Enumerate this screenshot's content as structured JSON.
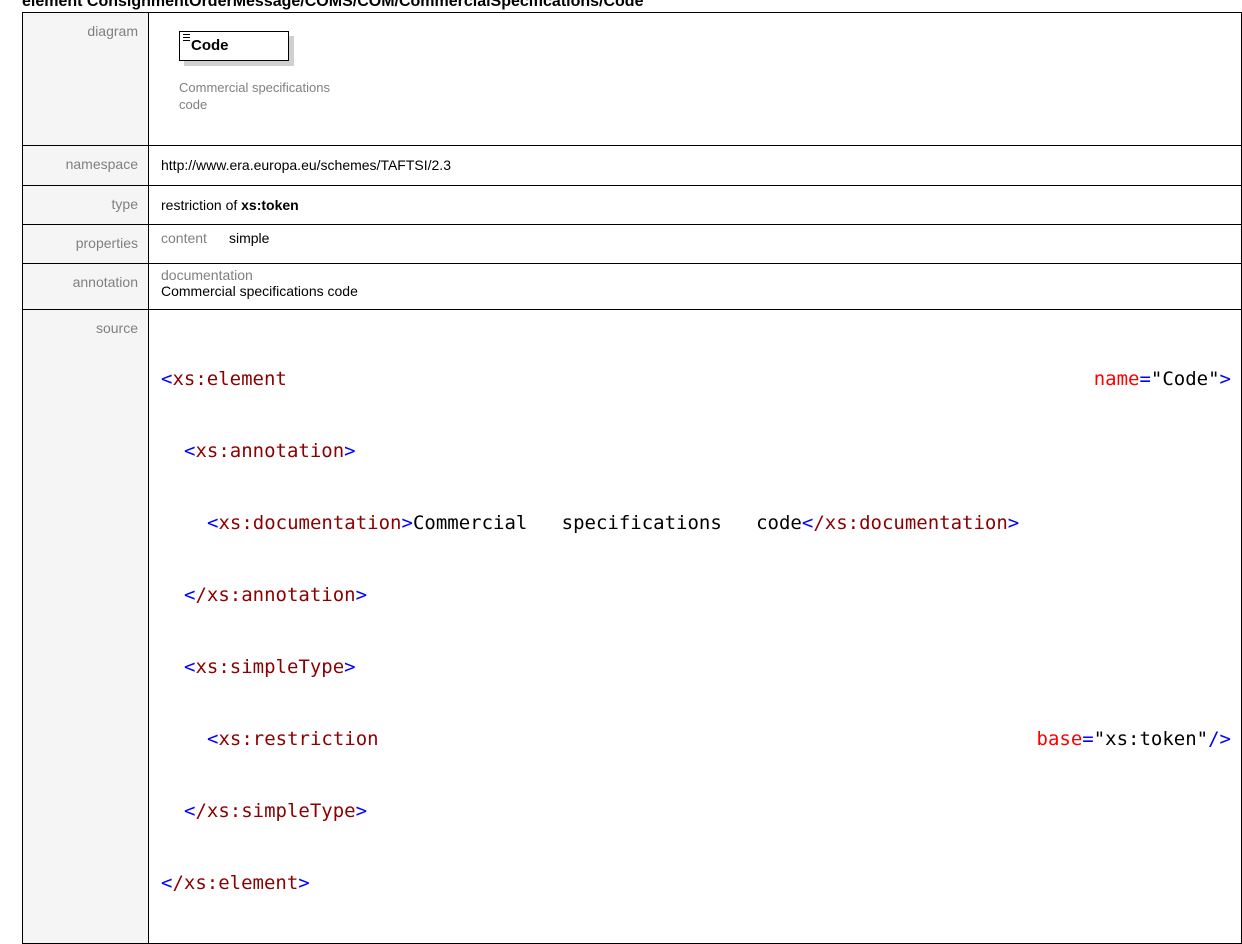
{
  "heading": "element ConsignmentOrderMessage/COMS/COM/CommercialSpecifications/Code",
  "labels": {
    "diagram": "diagram",
    "namespace": "namespace",
    "type": "type",
    "properties": "properties",
    "annotation": "annotation",
    "source": "source"
  },
  "diagram": {
    "element_name": "Code",
    "doc_line1": "Commercial specifications",
    "doc_line2": "code"
  },
  "namespace": "http://www.era.europa.eu/schemes/TAFTSI/2.3",
  "type": {
    "prefix": "restriction of",
    "base": "xs:token"
  },
  "properties": {
    "key": "content",
    "value": "simple"
  },
  "annotation": {
    "heading": "documentation",
    "text": "Commercial specifications code"
  },
  "source": {
    "l1_tag": "xs:element",
    "l1_attr": "name",
    "l1_val": "\"Code\"",
    "l2_tag": "xs:annotation",
    "l3_tag_open": "xs:documentation",
    "l3_text": "Commercial   specifications   code",
    "l3_tag_close": "/xs:documentation",
    "l4_tag": "/xs:annotation",
    "l5_tag": "xs:simpleType",
    "l6_tag": "xs:restriction",
    "l6_attr": "base",
    "l6_val": "\"xs:token\"",
    "l7_tag": "/xs:simpleType",
    "l8_tag": "/xs:element"
  },
  "colors": {
    "tag": "#8b0000",
    "bracket": "#0000ff",
    "attribute": "#ff0000",
    "label": "#808080"
  }
}
